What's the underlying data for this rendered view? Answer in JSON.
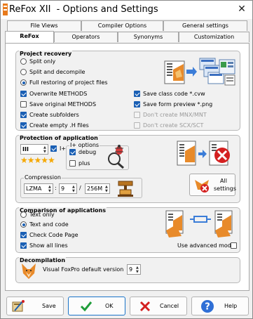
{
  "window": {
    "title": "ReFox XII  - Options and Settings",
    "close_glyph": "✕",
    "icon": "refox-app-icon"
  },
  "tabs": {
    "row1": [
      "File Views",
      "Compiler Options",
      "General settings"
    ],
    "row2": [
      "ReFox",
      "Operators",
      "Synonyms",
      "Customization"
    ],
    "active": "ReFox"
  },
  "project_recovery": {
    "title": "Project recovery",
    "radios": [
      {
        "label": "Split only",
        "checked": false
      },
      {
        "label": "Split and decompile",
        "checked": false
      },
      {
        "label": "Full restoring of project files",
        "checked": true
      }
    ],
    "left_checks": [
      {
        "label": "Overwrite METHODS",
        "checked": true
      },
      {
        "label": "Save original METHODS",
        "checked": false
      },
      {
        "label": "Create subfolders",
        "checked": true
      },
      {
        "label": "Create empty .H files",
        "checked": true
      }
    ],
    "right_checks": [
      {
        "label": "Save class code *.cvw",
        "checked": true,
        "disabled": false
      },
      {
        "label": "Save form preview *.png",
        "checked": true,
        "disabled": false
      },
      {
        "label": "Don't create MNX/MNT",
        "checked": false,
        "disabled": true
      },
      {
        "label": "Don't create SCX/SCT",
        "checked": false,
        "disabled": true
      }
    ]
  },
  "protection": {
    "title": "Protection of application",
    "level_value": "III",
    "iplus_label": "I+",
    "iplus_checked": true,
    "stars": "★★★★★",
    "iplus_options_title": "I+ options",
    "debug": {
      "label": "debug",
      "checked": true
    },
    "plus": {
      "label": "plus",
      "checked": false
    },
    "compression_title": "Compression",
    "compression_method": "LZMA",
    "compression_level": "9",
    "compression_separator": "/",
    "compression_dict": "256M",
    "all_settings_label": "All\nsettings"
  },
  "comparison": {
    "title": "Comparison of applications",
    "radios": [
      {
        "label": "Text only",
        "checked": false
      },
      {
        "label": "Text and code",
        "checked": true
      }
    ],
    "checks": [
      {
        "label": "Check Code Page",
        "checked": true
      },
      {
        "label": "Show all lines",
        "checked": true
      }
    ],
    "advanced": {
      "label": "Use advanced mode",
      "checked": false
    }
  },
  "decompilation": {
    "title": "Decompilation",
    "version_label": "Visual FoxPro default version",
    "version_value": "9"
  },
  "buttons": {
    "save": "Save",
    "ok": "OK",
    "cancel": "Cancel",
    "help": "Help"
  },
  "colors": {
    "accent": "#1a5fb4",
    "ok_check": "#1f9d3a",
    "cancel_x": "#d42020",
    "help_bg": "#2f6fd6",
    "star": "#f5a800"
  }
}
